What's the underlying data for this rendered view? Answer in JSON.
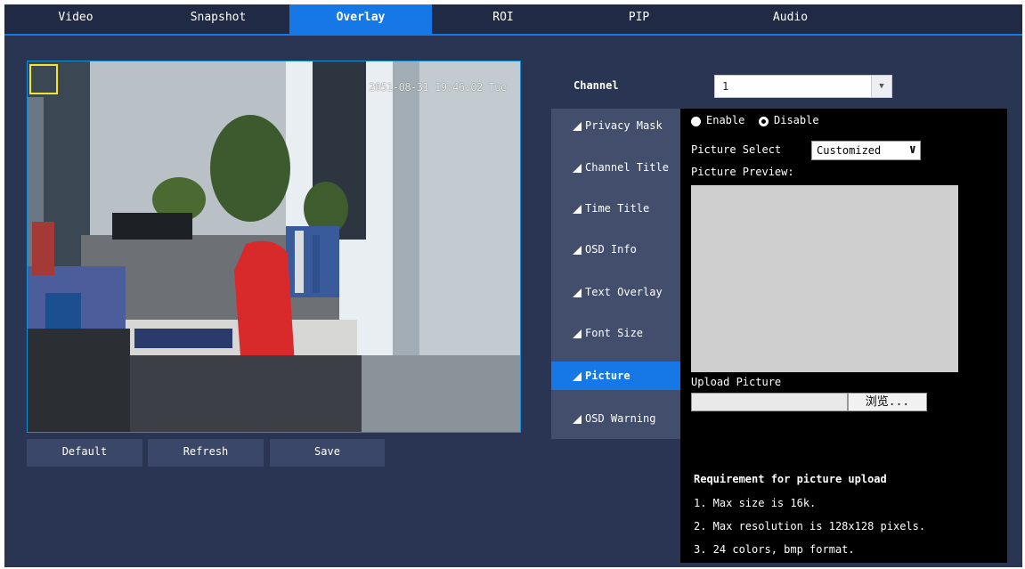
{
  "tabs": [
    {
      "label": "Video"
    },
    {
      "label": "Snapshot"
    },
    {
      "label": "Overlay"
    },
    {
      "label": "ROI"
    },
    {
      "label": "PIP"
    },
    {
      "label": "Audio"
    }
  ],
  "active_tab": "Overlay",
  "preview": {
    "timestamp": "2051-08-31 19:46:02 Tue"
  },
  "buttons": {
    "default": "Default",
    "refresh": "Refresh",
    "save": "Save"
  },
  "channel": {
    "label": "Channel",
    "value": "1"
  },
  "menu": [
    {
      "label": "Privacy Mask"
    },
    {
      "label": "Channel Title"
    },
    {
      "label": "Time Title"
    },
    {
      "label": "OSD Info"
    },
    {
      "label": "Text Overlay"
    },
    {
      "label": "Font Size"
    },
    {
      "label": "Picture"
    },
    {
      "label": "OSD Warning"
    }
  ],
  "active_menu": "Picture",
  "picture_panel": {
    "enable_label": "Enable",
    "disable_label": "Disable",
    "selected": "Disable",
    "picture_select_label": "Picture Select",
    "picture_select_value": "Customized",
    "picture_preview_label": "Picture Preview:",
    "upload_label": "Upload Picture",
    "upload_value": "",
    "browse_label": "浏览...",
    "requirements_title": "Requirement for picture upload",
    "requirements": [
      "1. Max size is 16k.",
      "2. Max resolution is 128x128 pixels.",
      "3. 24 colors, bmp format."
    ]
  },
  "colors": {
    "background": "#2a3553",
    "tab_bar": "#202a44",
    "accent": "#1677e6",
    "menu_bg": "#434e6c",
    "panel_bg": "#000000"
  }
}
